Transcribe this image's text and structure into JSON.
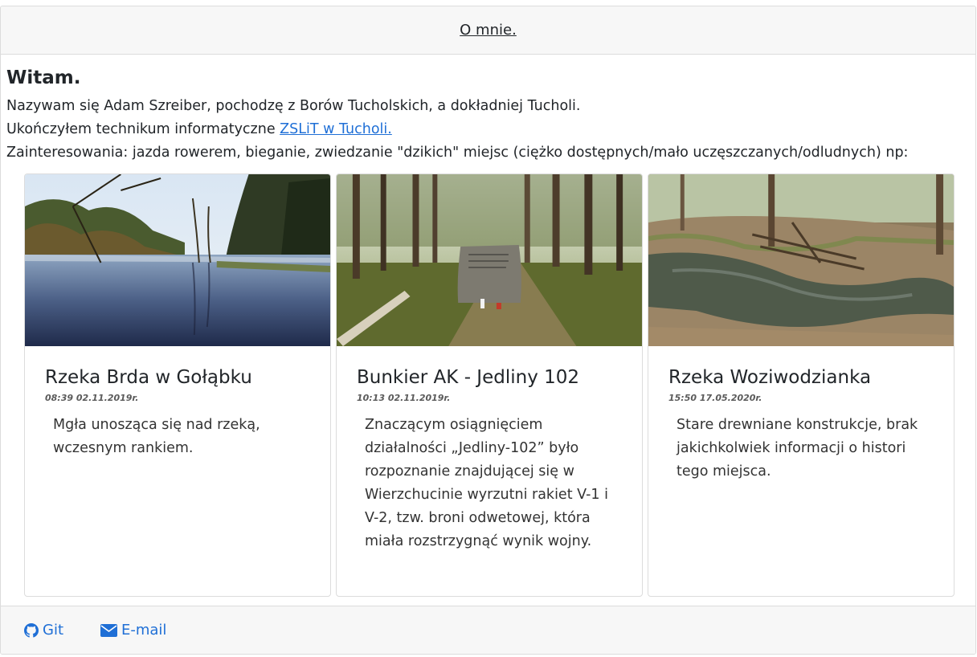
{
  "header": {
    "about_link": "O mnie."
  },
  "intro": {
    "title": "Witam.",
    "line1": "Nazywam się Adam Szreiber, pochodzę z Borów Tucholskich, a dokładniej Tucholi.",
    "line2_prefix": "Ukończyłem technikum informatyczne ",
    "line2_link": "ZSLiT w Tucholi.",
    "line3": "Zainteresowania: jazda rowerem, bieganie, zwiedzanie \"dzikich\" miejsc (ciężko dostępnych/mało uczęszczanych/odludnych) np:"
  },
  "places": [
    {
      "title": "Rzeka Brda w Gołąbku",
      "date": "08:39 02.11.2019r.",
      "description": "Mgła unosząca się nad rzeką, wczesnym rankiem.",
      "photo": "river-photo"
    },
    {
      "title": "Bunkier AK - Jedliny 102",
      "date": "10:13 02.11.2019r.",
      "description": "Znaczącym osiągnięciem działalności „Jedliny-102” było rozpoznanie znajdującej się w Wierzchucinie wyrzutni rakiet V-1 i V-2, tzw. broni odwetowej, która miała rozstrzygnąć wynik wojny.",
      "photo": "forest-memorial-photo"
    },
    {
      "title": "Rzeka Woziwodzianka",
      "date": "15:50 17.05.2020r.",
      "description": "Stare drewniane konstrukcje, brak jakichkolwiek informacji o histori tego miejsca.",
      "photo": "forest-stream-photo"
    }
  ],
  "footer": {
    "git_label": "Git",
    "email_label": "E-mail",
    "git_icon": "github-icon",
    "email_icon": "envelope-icon"
  },
  "colors": {
    "link": "#1f6fd6",
    "header_bg": "#f7f7f7",
    "border": "#dcdcdc"
  }
}
